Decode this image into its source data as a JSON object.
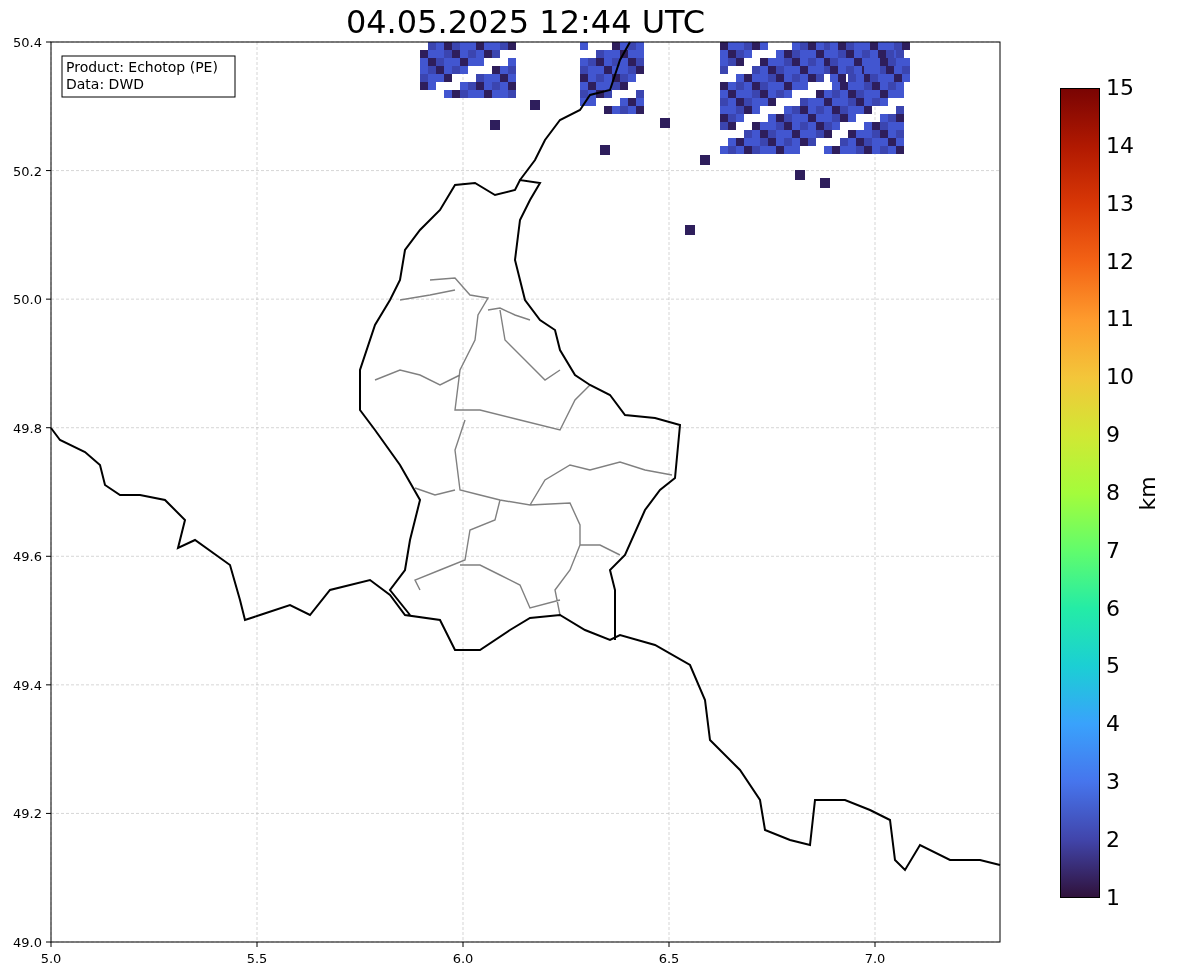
{
  "title": "04.05.2025 12:44 UTC",
  "info_box": [
    "Product: Echotop (PE)",
    "Data: DWD"
  ],
  "x_axis": {
    "ticks": [
      "5.0",
      "5.5",
      "6.0",
      "6.5",
      "7.0"
    ]
  },
  "y_axis": {
    "ticks": [
      "50.4",
      "50.2",
      "50.0",
      "49.8",
      "49.6",
      "49.4",
      "49.2",
      "49.0"
    ]
  },
  "colorbar": {
    "label": "km",
    "ticks": [
      "15",
      "14",
      "13",
      "12",
      "11",
      "10",
      "9",
      "8",
      "7",
      "6",
      "5",
      "4",
      "3",
      "2",
      "1"
    ]
  }
}
